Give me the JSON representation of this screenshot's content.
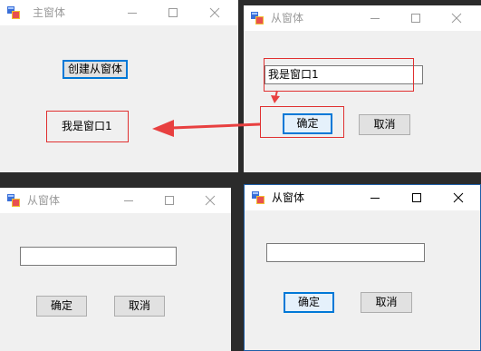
{
  "main_window": {
    "title": "主窗体",
    "create_button_label": "创建从窗体",
    "message_label": "我是窗口1"
  },
  "child_window_filled": {
    "title": "从窗体",
    "textbox_value": "我是窗口1",
    "ok_label": "确定",
    "cancel_label": "取消"
  },
  "child_window_empty": {
    "title": "从窗体",
    "textbox_value": "",
    "ok_label": "确定",
    "cancel_label": "取消"
  },
  "child_window_active": {
    "title": "从窗体",
    "textbox_value": "",
    "ok_label": "确定",
    "cancel_label": "取消"
  },
  "colors": {
    "highlight_red": "#e03030",
    "arrow_red": "#e84040",
    "focus_blue": "#0078d7",
    "desktop": "#2b2b2b"
  }
}
